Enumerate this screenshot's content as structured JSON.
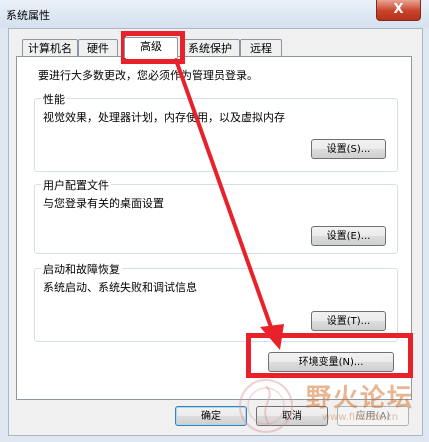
{
  "window": {
    "title": "系统属性",
    "close_glyph": "X"
  },
  "tabs": [
    {
      "label": "计算机名",
      "active": false
    },
    {
      "label": "硬件",
      "active": false
    },
    {
      "label": "高级",
      "active": true
    },
    {
      "label": "系统保护",
      "active": false
    },
    {
      "label": "远程",
      "active": false
    }
  ],
  "advanced": {
    "intro": "要进行大多数更改，您必须作为管理员登录。",
    "performance": {
      "title": "性能",
      "description": "视觉效果，处理器计划，内存使用，以及虚拟内存",
      "button": "设置(S)..."
    },
    "user_profiles": {
      "title": "用户配置文件",
      "description": "与您登录有关的桌面设置",
      "button": "设置(E)..."
    },
    "startup_recovery": {
      "title": "启动和故障恢复",
      "description": "系统启动、系统失败和调试信息",
      "button": "设置(T)..."
    },
    "env_button": "环境变量(N)..."
  },
  "footer": {
    "ok": "确定",
    "cancel": "取消",
    "apply": "应用(A)"
  },
  "watermark": {
    "text": "野火论坛",
    "sub": "www.firebbs.cn"
  },
  "colors": {
    "annotation": "#e8212b",
    "close_button": "#c7432a"
  }
}
